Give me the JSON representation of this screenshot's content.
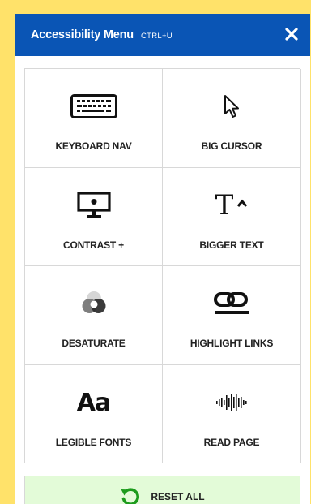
{
  "colors": {
    "page_background": "#ffe26a",
    "header_background": "#0a55b5",
    "header_text": "#ffffff",
    "reset_background": "#e3fbd8",
    "reset_icon": "#1c9b1c"
  },
  "header": {
    "title": "Accessibility Menu",
    "shortcut": "CTRL+U",
    "close_icon": "close-icon"
  },
  "tiles": [
    {
      "label": "KEYBOARD NAV",
      "icon": "keyboard-icon"
    },
    {
      "label": "BIG CURSOR",
      "icon": "cursor-icon"
    },
    {
      "label": "CONTRAST +",
      "icon": "monitor-icon"
    },
    {
      "label": "BIGGER TEXT",
      "icon": "text-size-icon",
      "glyph": "T"
    },
    {
      "label": "DESATURATE",
      "icon": "desaturate-icon"
    },
    {
      "label": "HIGHLIGHT LINKS",
      "icon": "link-icon"
    },
    {
      "label": "LEGIBLE FONTS",
      "icon": "font-icon",
      "glyph": "Aa"
    },
    {
      "label": "READ PAGE",
      "icon": "audio-waveform-icon"
    }
  ],
  "reset": {
    "label": "RESET ALL",
    "icon": "reset-icon"
  }
}
